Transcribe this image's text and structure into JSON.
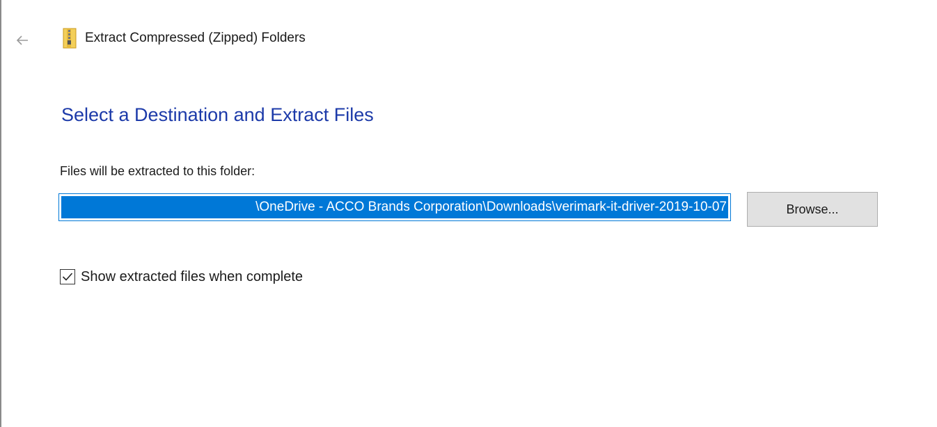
{
  "dialog": {
    "title": "Extract Compressed (Zipped) Folders",
    "main_instruction": "Select a Destination and Extract Files",
    "destination_label": "Files will be extracted to this folder:",
    "destination_path": "\\OneDrive - ACCO Brands Corporation\\Downloads\\verimark-it-driver-2019-10-07",
    "browse_label": "Browse...",
    "show_files_label": "Show extracted files when complete",
    "show_files_checked": true
  },
  "icons": {
    "back": "back-arrow-icon",
    "app": "zip-folder-icon",
    "check": "checkmark-icon"
  },
  "colors": {
    "accent": "#0078d7",
    "instruction_text": "#1c3aa9",
    "button_bg": "#e1e1e1"
  }
}
